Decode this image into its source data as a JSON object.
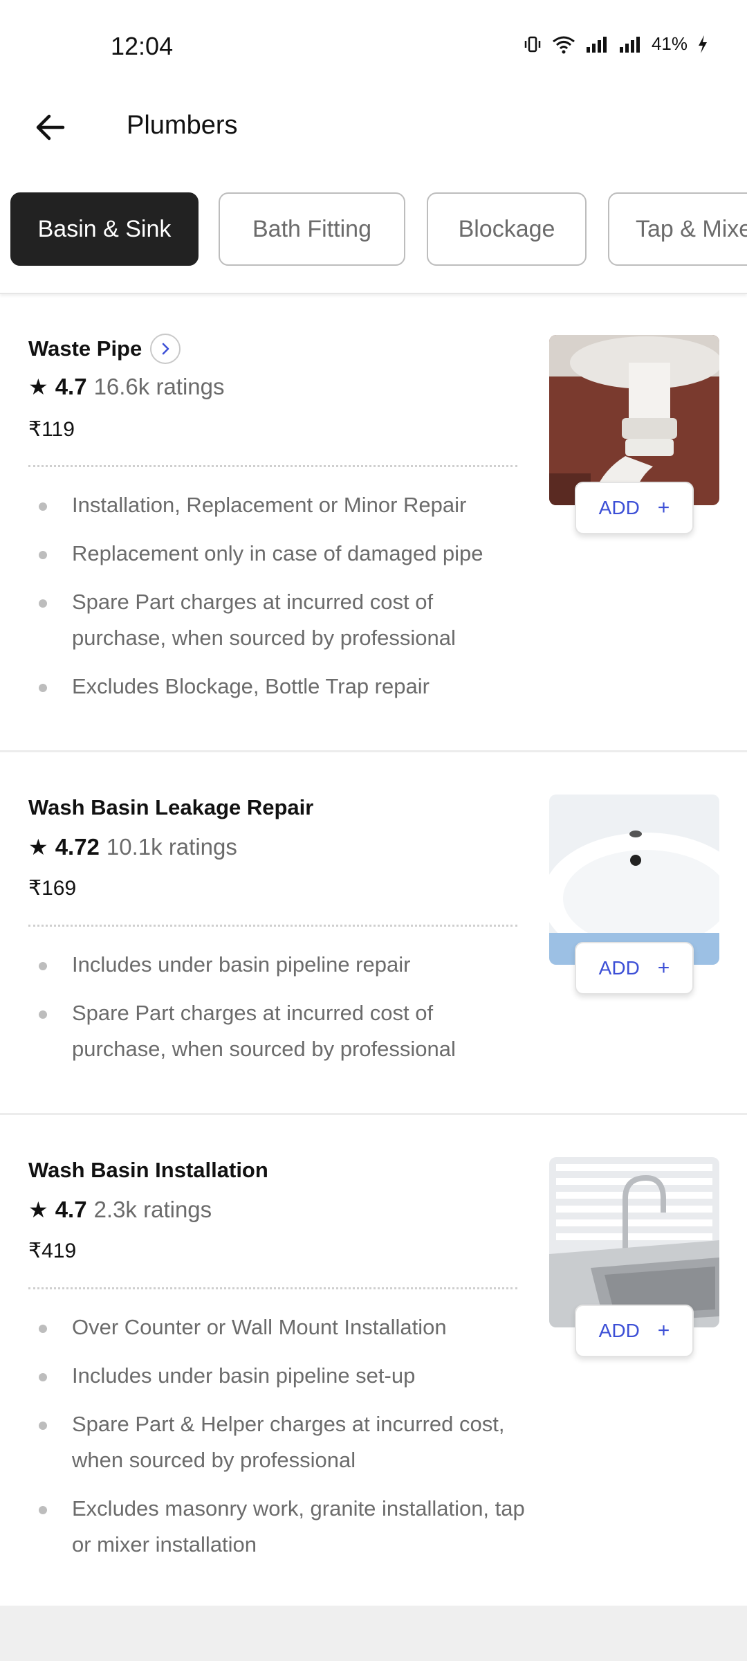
{
  "status_bar": {
    "time": "12:04",
    "battery": "41%"
  },
  "header": {
    "title": "Plumbers"
  },
  "tabs": [
    {
      "label": "Basin & Sink",
      "active": true
    },
    {
      "label": "Bath Fitting",
      "active": false
    },
    {
      "label": "Blockage",
      "active": false
    },
    {
      "label": "Tap & Mixe",
      "active": false
    }
  ],
  "services": [
    {
      "title": "Waste Pipe",
      "rating": "4.7",
      "ratings_count": "16.6k ratings",
      "price": "₹119",
      "add_label": "ADD",
      "add_plus": "+",
      "bullets": [
        "Installation, Replacement or Minor Repair",
        "Replacement only in case of damaged pipe",
        "Spare Part charges at incurred cost of purchase, when sourced by professional",
        "Excludes Blockage, Bottle Trap repair"
      ]
    },
    {
      "title": "Wash Basin Leakage Repair",
      "rating": "4.72",
      "ratings_count": "10.1k ratings",
      "price": "₹169",
      "add_label": "ADD",
      "add_plus": "+",
      "bullets": [
        "Includes under basin pipeline repair",
        "Spare Part charges at incurred cost of purchase, when sourced by professional"
      ]
    },
    {
      "title": "Wash Basin Installation",
      "rating": "4.7",
      "ratings_count": "2.3k ratings",
      "price": "₹419",
      "add_label": "ADD",
      "add_plus": "+",
      "bullets": [
        "Over Counter or Wall Mount Installation",
        "Includes under basin pipeline set-up",
        "Spare Part & Helper charges at incurred cost, when sourced by professional",
        "Excludes masonry work, granite installation, tap or mixer installation"
      ]
    }
  ],
  "colors": {
    "accent": "#3c4fd6",
    "active_tab": "#222222",
    "muted_text": "#6b6b6b"
  }
}
